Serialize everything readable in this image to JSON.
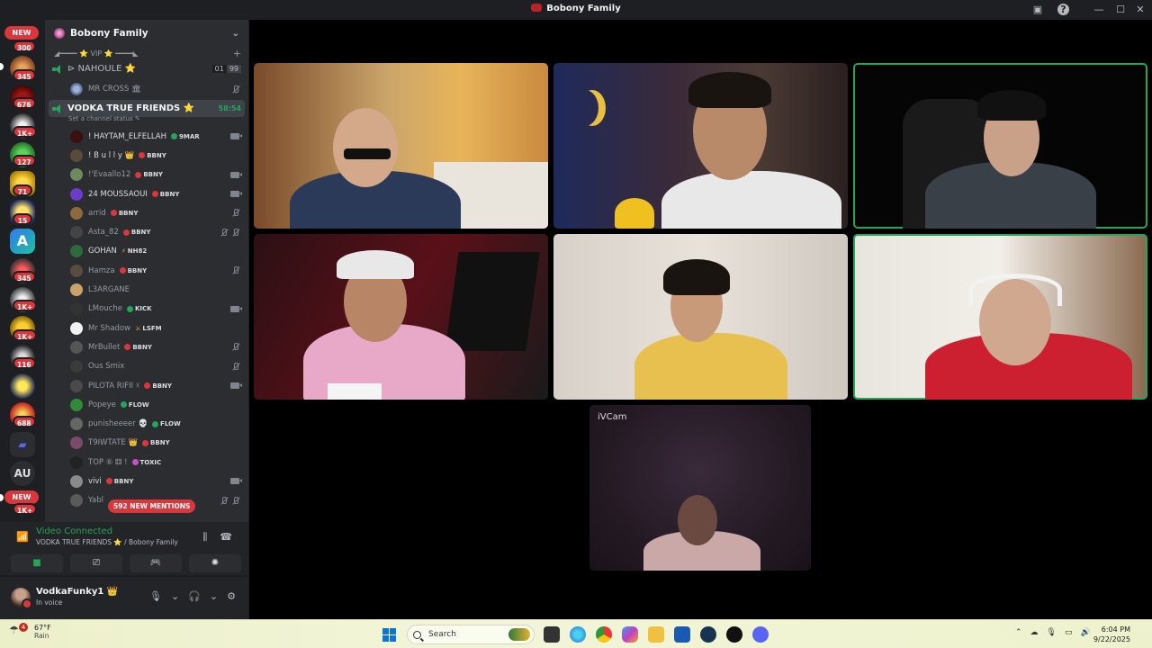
{
  "window": {
    "title": "Bobony Family"
  },
  "rail": {
    "badges": [
      "300",
      "345",
      "676",
      "1K+",
      "127",
      "71",
      "15",
      "345",
      "1K+",
      "1K+",
      "116",
      "688",
      "1K+"
    ],
    "new_label": "NEW",
    "au_label": "AU",
    "a_label": "A"
  },
  "server": {
    "name": "Bobony Family",
    "category": "◢━━━━ ⭐ VIP ⭐ ━━━━◣",
    "channels": [
      {
        "name": "⊳ NAHOULE ⭐",
        "count_a": "01",
        "count_b": "99"
      },
      {
        "name": "VODKA TRUE FRIENDS ⭐",
        "timer": "58:54",
        "status_placeholder": "Set a channel status"
      }
    ],
    "member_mrcross": "MR CROSS 🏛",
    "members": [
      {
        "name": "! HAYTAM_ELFELLAH",
        "tag": "9MAR",
        "bright": true
      },
      {
        "name": "! B u l l y 👑",
        "tag": "BBNY",
        "bright": true
      },
      {
        "name": "!'Evaallo12",
        "tag": "BBNY",
        "bright": false
      },
      {
        "name": "24 MOUSSAOUI",
        "tag": "BBNY",
        "bright": true
      },
      {
        "name": "arrid",
        "tag": "BBNY",
        "bright": false
      },
      {
        "name": "Asta_82",
        "tag": "BBNY",
        "bright": false
      },
      {
        "name": "GOHAN",
        "tag": "NH82",
        "bright": true
      },
      {
        "name": "Hamza",
        "tag": "BBNY",
        "bright": false
      },
      {
        "name": "L3ARGANE",
        "tag": "",
        "bright": false
      },
      {
        "name": "LMouche",
        "tag": "KICK",
        "bright": false
      },
      {
        "name": "Mr Shadow",
        "tag": "LSFM",
        "bright": false
      },
      {
        "name": "MrBullet",
        "tag": "BBNY",
        "bright": false
      },
      {
        "name": "Ous Smix",
        "tag": "",
        "bright": false
      },
      {
        "name": "PILOTA RIFII ☓",
        "tag": "BBNY",
        "bright": false
      },
      {
        "name": "Popeye",
        "tag": "FLOW",
        "bright": false
      },
      {
        "name": "punisheeeer 💀",
        "tag": "FLOW",
        "bright": false
      },
      {
        "name": "T9IWTATE 👑",
        "tag": "BBNY",
        "bright": false
      },
      {
        "name": "TOP ⑥ ⚅ !",
        "tag": "TOXIC",
        "bright": false
      },
      {
        "name": "vivi",
        "tag": "BBNY",
        "bright": true
      },
      {
        "name": "Yabl",
        "tag": "",
        "bright": false
      }
    ],
    "mentions_label": "592 NEW MENTIONS"
  },
  "voice": {
    "status": "Video Connected",
    "location": "VODKA TRUE FRIENDS ⭐ / Bobony Family"
  },
  "user": {
    "name": "VodkaFunky1 👑",
    "status": "In voice"
  },
  "stage": {
    "ivcam_label": "iVCam"
  },
  "taskbar": {
    "temp": "67°F",
    "condition": "Rain",
    "weather_badge": "4",
    "search_label": "Search",
    "time": "6:04 PM",
    "date": "9/22/2025"
  },
  "colors": {
    "accent_green": "#23a55a",
    "danger_red": "#da373c",
    "sidebar": "#2b2d31",
    "rail": "#1e1f22"
  }
}
